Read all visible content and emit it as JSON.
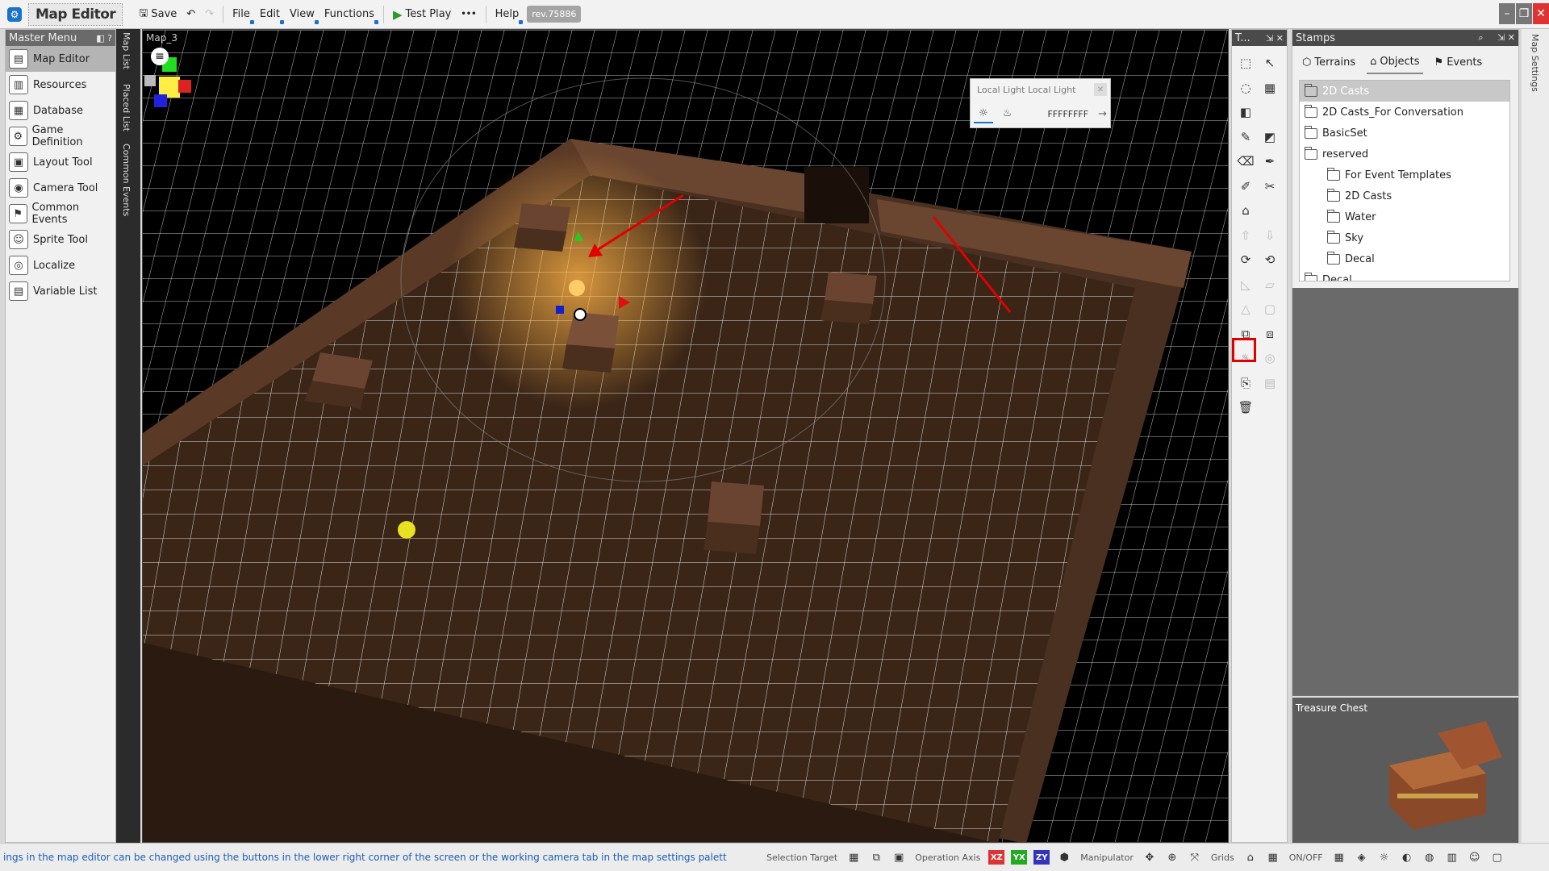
{
  "app": {
    "title": "Map Editor",
    "revision": "rev.75886"
  },
  "toolbar": {
    "save": "Save",
    "menus": [
      "File",
      "Edit",
      "View",
      "Functions"
    ],
    "test_play": "Test Play",
    "more": "•••",
    "help": "Help"
  },
  "master_menu": {
    "title": "Master Menu",
    "items": [
      {
        "label": "Map Editor",
        "icon": "map-editor-icon"
      },
      {
        "label": "Resources",
        "icon": "resources-icon"
      },
      {
        "label": "Database",
        "icon": "database-icon"
      },
      {
        "label": "Game Definition",
        "icon": "game-definition-icon"
      },
      {
        "label": "Layout Tool",
        "icon": "layout-tool-icon"
      },
      {
        "label": "Camera Tool",
        "icon": "camera-tool-icon"
      },
      {
        "label": "Common Events",
        "icon": "common-events-icon"
      },
      {
        "label": "Sprite Tool",
        "icon": "sprite-tool-icon"
      },
      {
        "label": "Localize",
        "icon": "localize-icon"
      },
      {
        "label": "Variable List",
        "icon": "variable-list-icon"
      }
    ]
  },
  "vertical_tabs": [
    "Map List",
    "Placed List",
    "Common Events"
  ],
  "viewport": {
    "map_name": "Map_3"
  },
  "light_popup": {
    "title": "Local Light Local Light",
    "color_value": "FFFFFFFF"
  },
  "tools_panel": {
    "title": "T..."
  },
  "stamps": {
    "title": "Stamps",
    "tabs": [
      "Terrains",
      "Objects",
      "Events"
    ],
    "tree": [
      {
        "label": "2D Casts",
        "level": 0,
        "selected": true
      },
      {
        "label": "2D Casts_For Conversation",
        "level": 0
      },
      {
        "label": "BasicSet",
        "level": 0
      },
      {
        "label": "reserved",
        "level": 0
      },
      {
        "label": "For Event Templates",
        "level": 1
      },
      {
        "label": "2D Casts",
        "level": 1
      },
      {
        "label": "Water",
        "level": 1
      },
      {
        "label": "Sky",
        "level": 1
      },
      {
        "label": "Decal",
        "level": 1
      },
      {
        "label": "Decal",
        "level": 0
      }
    ],
    "preview_title": "Treasure Chest"
  },
  "map_settings_tab": "Map Settings",
  "status": {
    "message": "ings in the map editor can be changed using the buttons in the lower right corner of the screen or the working camera tab in the map settings palett",
    "selection_target": "Selection Target",
    "operation_axis": "Operation Axis",
    "axes": [
      "XZ",
      "YX",
      "ZY"
    ],
    "manipulator": "Manipulator",
    "grids": "Grids",
    "onoff": "ON/OFF"
  },
  "colors": {
    "accent": "#1a73c9",
    "highlight": "#e00000",
    "floor": "#3a2517",
    "wall": "#5a3a26"
  }
}
